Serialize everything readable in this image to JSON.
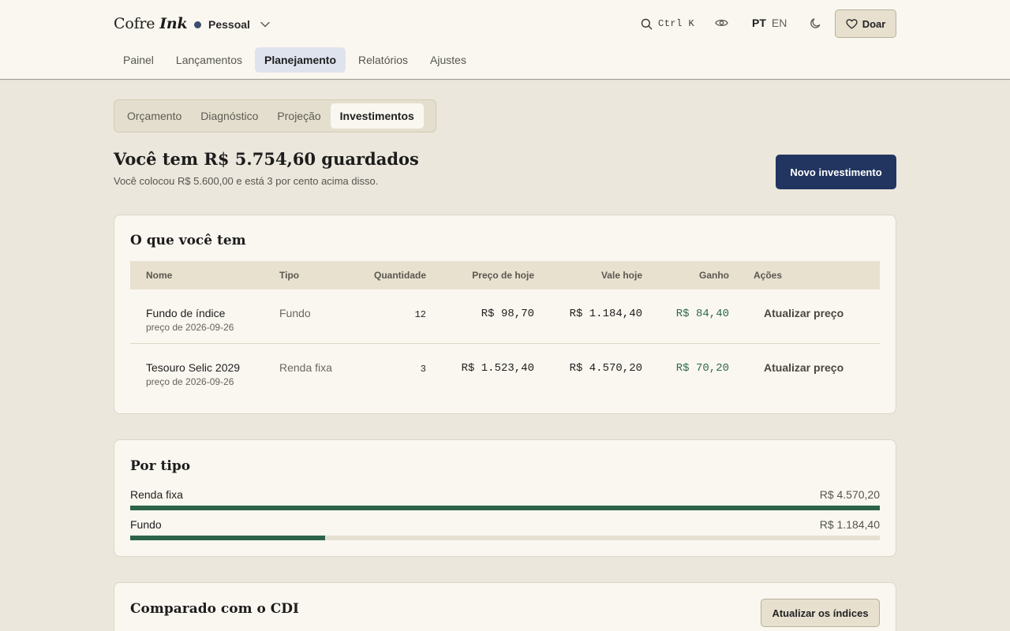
{
  "header": {
    "brand_main": "Cofre",
    "brand_accent": "Ink",
    "ledger": "Pessoal",
    "search_shortcut": "Ctrl K",
    "lang_active": "PT",
    "lang_other": "EN",
    "donate": "Doar"
  },
  "nav": {
    "items": [
      "Painel",
      "Lançamentos",
      "Planejamento",
      "Relatórios",
      "Ajustes"
    ],
    "active": "Planejamento"
  },
  "subtabs": {
    "items": [
      "Orçamento",
      "Diagnóstico",
      "Projeção",
      "Investimentos"
    ],
    "active": "Investimentos"
  },
  "summary": {
    "title": "Você tem R$ 5.754,60 guardados",
    "subtitle": "Você colocou R$ 5.600,00 e está 3 por cento acima disso.",
    "new_button": "Novo investimento"
  },
  "holdings": {
    "title": "O que você tem",
    "columns": {
      "name": "Nome",
      "type": "Tipo",
      "quantity": "Quantidade",
      "price": "Preço de hoje",
      "value": "Vale hoje",
      "gain": "Ganho",
      "actions": "Ações"
    },
    "rows": [
      {
        "name": "Fundo de índice",
        "price_date": "preço de 2026-09-26",
        "type": "Fundo",
        "quantity": "12",
        "price": "R$ 98,70",
        "value": "R$ 1.184,40",
        "gain": "R$ 84,40",
        "action": "Atualizar preço"
      },
      {
        "name": "Tesouro Selic 2029",
        "price_date": "preço de 2026-09-26",
        "type": "Renda fixa",
        "quantity": "3",
        "price": "R$ 1.523,40",
        "value": "R$ 4.570,20",
        "gain": "R$ 70,20",
        "action": "Atualizar preço"
      }
    ]
  },
  "by_type": {
    "title": "Por tipo",
    "items": [
      {
        "label": "Renda fixa",
        "amount": "R$ 4.570,20",
        "fraction": 1.0
      },
      {
        "label": "Fundo",
        "amount": "R$ 1.184,40",
        "fraction": 0.26
      }
    ]
  },
  "cdi": {
    "title": "Comparado com o CDI",
    "button": "Atualizar os índices"
  },
  "colors": {
    "primary": "#223560",
    "gain": "#2f6a4a",
    "bar": "#2d6349",
    "background": "#ece7dc",
    "card": "#faf7f0"
  }
}
